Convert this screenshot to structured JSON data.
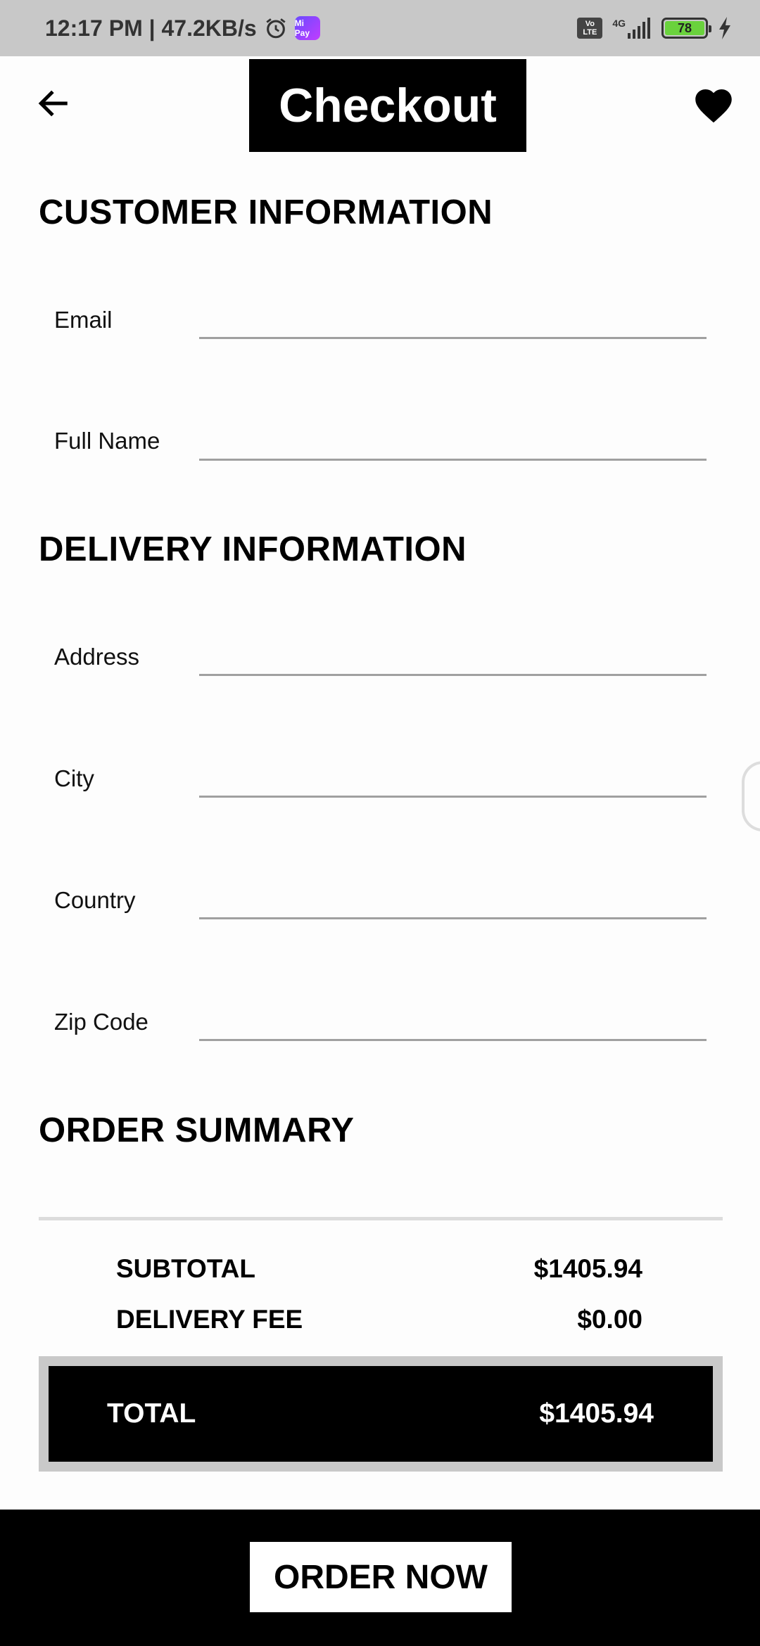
{
  "status_bar": {
    "time_speed": "12:17 PM | 47.2KB/s",
    "mipay_label": "Mi Pay",
    "volte_label": "Vo LTE",
    "network": "4G",
    "battery": "78"
  },
  "header": {
    "title": "Checkout"
  },
  "customer": {
    "heading": "CUSTOMER INFORMATION",
    "email_label": "Email",
    "email_value": "",
    "fullname_label": "Full Name",
    "fullname_value": ""
  },
  "delivery": {
    "heading": "DELIVERY INFORMATION",
    "address_label": "Address",
    "address_value": "",
    "city_label": "City",
    "city_value": "",
    "country_label": "Country",
    "country_value": "",
    "zip_label": "Zip Code",
    "zip_value": ""
  },
  "summary": {
    "heading": "ORDER SUMMARY",
    "subtotal_label": "SUBTOTAL",
    "subtotal_value": "$1405.94",
    "delivery_fee_label": "DELIVERY FEE",
    "delivery_fee_value": "$0.00",
    "total_label": "TOTAL",
    "total_value": "$1405.94"
  },
  "footer": {
    "order_button": "ORDER NOW"
  },
  "icons": {
    "back": "arrow-left-icon",
    "favorite": "heart-icon",
    "alarm": "alarm-clock-icon",
    "signal": "signal-bars-icon",
    "charging": "lightning-bolt-icon"
  },
  "colors": {
    "primary": "#000000",
    "background": "#fdfdfd",
    "status_bar": "#c8c8c8",
    "battery": "#6ad23d"
  }
}
